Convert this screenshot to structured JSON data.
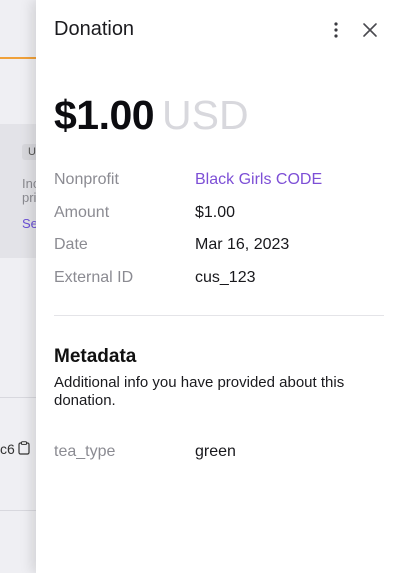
{
  "background": {
    "chip_text": "U",
    "text_line1": "Inc",
    "text_line2": "pri",
    "link_text": "Se",
    "code_text": "c6"
  },
  "drawer": {
    "title": "Donation",
    "amount": "$1.00",
    "currency": "USD",
    "details": [
      {
        "label": "Nonprofit",
        "value": "Black Girls CODE"
      },
      {
        "label": "Amount",
        "value": "$1.00"
      },
      {
        "label": "Date",
        "value": "Mar 16, 2023"
      },
      {
        "label": "External ID",
        "value": "cus_123"
      }
    ],
    "metadata": {
      "title": "Metadata",
      "description": "Additional info you have provided about this donation.",
      "items": [
        {
          "label": "tea_type",
          "value": "green"
        }
      ]
    }
  },
  "colors": {
    "accent_link": "#7d4fd6",
    "background_accent": "#f0a13a"
  },
  "icons": {
    "more": "kebab-menu-icon",
    "close": "close-icon",
    "copy": "clipboard-icon"
  }
}
